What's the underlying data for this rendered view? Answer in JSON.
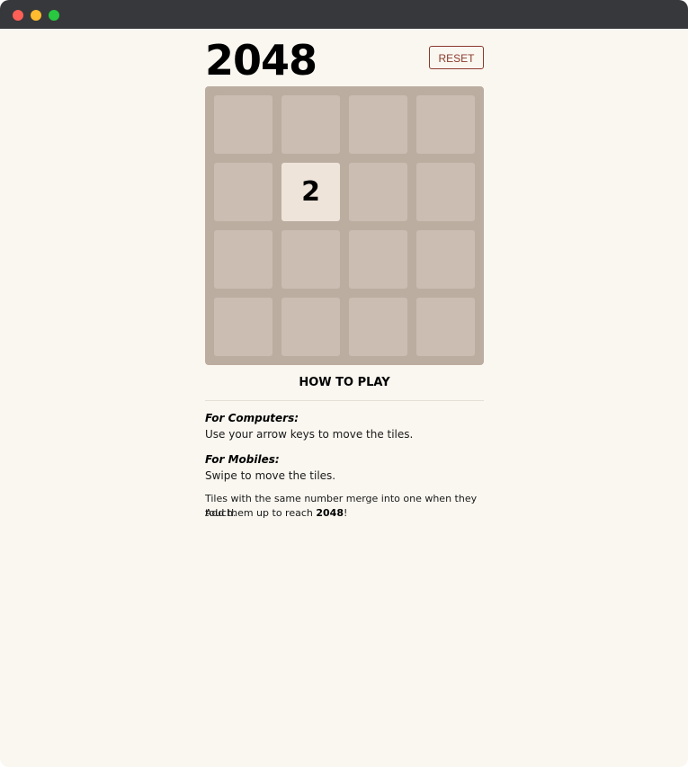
{
  "title": "2048",
  "reset_label": "RESET",
  "board": {
    "rows": [
      [
        "",
        "",
        "",
        ""
      ],
      [
        "",
        "2",
        "",
        ""
      ],
      [
        "",
        "",
        "",
        ""
      ],
      [
        "",
        "",
        "",
        ""
      ]
    ]
  },
  "instructions": {
    "heading": "HOW TO PLAY",
    "computers_title": "For Computers:",
    "computers_text": "Use your arrow keys to move the tiles.",
    "mobiles_title": "For Mobiles:",
    "mobiles_text": "Swipe to move the tiles.",
    "merge_line1": "Tiles with the same number merge into one when they touch.",
    "merge_line2_prefix": "Add them up to reach ",
    "merge_line2_target": "2048",
    "merge_line2_suffix": "!"
  },
  "colors": {
    "background": "#faf7f0",
    "board": "#bbada0",
    "empty_cell": "#cbbdb2",
    "tile_2": "#eee4da",
    "accent": "#8b3a2b",
    "titlebar": "#37383b"
  }
}
